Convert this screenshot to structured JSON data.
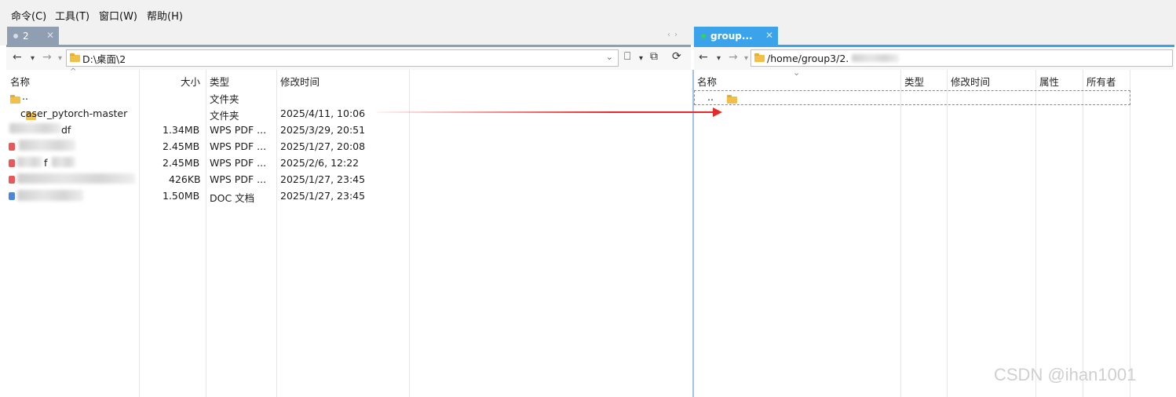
{
  "menu": {
    "items": [
      "命令(C)",
      "工具(T)",
      "窗口(W)",
      "帮助(H)"
    ]
  },
  "tabs": {
    "left": {
      "label": "2"
    },
    "right": {
      "label": "group..."
    }
  },
  "left_pane": {
    "path": "D:\\桌面\\2",
    "columns": [
      "名称",
      "大小",
      "类型",
      "修改时间"
    ],
    "rows": [
      {
        "name": "..",
        "size": "",
        "type": "文件夹",
        "modified": ""
      },
      {
        "name": "caser_pytorch-master",
        "size": "",
        "type": "文件夹",
        "modified": "2025/4/11, 10:06"
      },
      {
        "name": "df",
        "size": "1.34MB",
        "type": "WPS PDF ...",
        "modified": "2025/3/29, 20:51"
      },
      {
        "name": "",
        "size": "2.45MB",
        "type": "WPS PDF ...",
        "modified": "2025/1/27, 20:08"
      },
      {
        "name": "f",
        "size": "2.45MB",
        "type": "WPS PDF ...",
        "modified": "2025/2/6, 12:22"
      },
      {
        "name": "",
        "size": "426KB",
        "type": "WPS PDF ...",
        "modified": "2025/1/27, 23:45"
      },
      {
        "name": "",
        "size": "1.50MB",
        "type": "DOC 文档",
        "modified": "2025/1/27, 23:45"
      }
    ]
  },
  "right_pane": {
    "path": "/home/group3/2.",
    "columns": [
      "名称",
      "类型",
      "修改时间",
      "属性",
      "所有者"
    ],
    "rows": [
      {
        "name": ".."
      }
    ]
  },
  "watermark": "CSDN @ihan1001",
  "icons": {
    "back": "←",
    "dropdown": "▾",
    "forward": "→",
    "bookmark": "🔖",
    "refresh": "⟳"
  },
  "colors": {
    "left_tab": "#8f9eb0",
    "right_tab": "#3aa3ea",
    "arrow": "#e62a2a",
    "folder": "#f0c049"
  }
}
